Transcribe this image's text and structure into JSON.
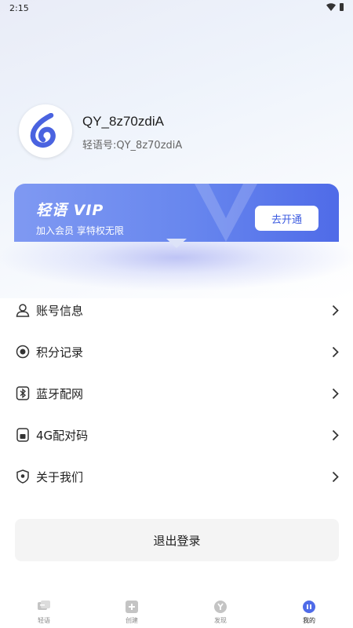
{
  "status_bar": {
    "time": "2:15"
  },
  "profile": {
    "username": "QY_8z70zdiA",
    "user_id_text": "轻语号:QY_8z70zdiA"
  },
  "vip": {
    "title": "轻语 VIP",
    "subtitle": "加入会员 享特权无限",
    "button_label": "去开通"
  },
  "menu": [
    {
      "label": "账号信息",
      "icon": "person-icon"
    },
    {
      "label": "积分记录",
      "icon": "points-icon"
    },
    {
      "label": "蓝牙配网",
      "icon": "bluetooth-icon"
    },
    {
      "label": "4G配对码",
      "icon": "sim-icon"
    },
    {
      "label": "关于我们",
      "icon": "shield-icon"
    }
  ],
  "logout_label": "退出登录",
  "tabs": [
    {
      "label": "轻语",
      "icon": "chat-icon",
      "active": false
    },
    {
      "label": "创建",
      "icon": "plus-icon",
      "active": false
    },
    {
      "label": "发现",
      "icon": "discover-icon",
      "active": false
    },
    {
      "label": "我的",
      "icon": "me-icon",
      "active": true
    }
  ],
  "colors": {
    "accent": "#4f6be8",
    "vip_gradient_start": "#7f99f2",
    "vip_gradient_end": "#4f6be8"
  }
}
